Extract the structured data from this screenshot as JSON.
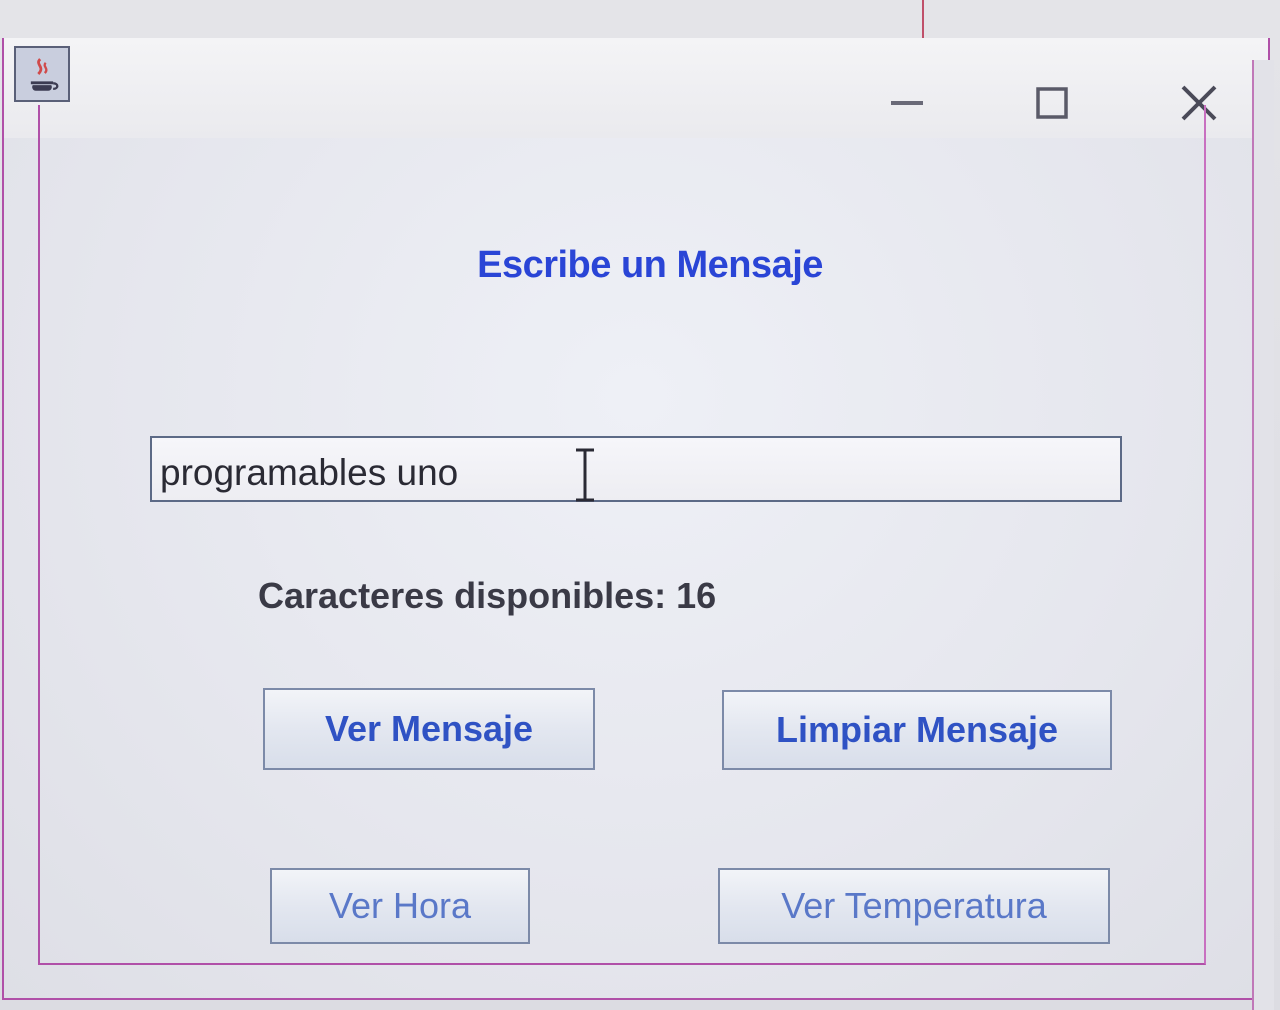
{
  "window": {
    "title": "",
    "controls": {
      "minimize_icon": "minimize-icon",
      "maximize_icon": "maximize-icon",
      "close_icon": "close-icon"
    },
    "app_icon": "java-icon"
  },
  "main": {
    "heading": "Escribe un Mensaje",
    "message_input": {
      "value": "programables uno",
      "placeholder": ""
    },
    "counter_text": "Caracteres disponibles: 16",
    "buttons": {
      "ver_mensaje": "Ver Mensaje",
      "limpiar_mensaje": "Limpiar Mensaje",
      "ver_hora": "Ver Hora",
      "ver_temperatura": "Ver Temperatura"
    }
  },
  "colors": {
    "heading": "#2a45d6",
    "button_text": "#2f52c4",
    "window_border": "#b050a8",
    "background": "#eeeeef"
  }
}
